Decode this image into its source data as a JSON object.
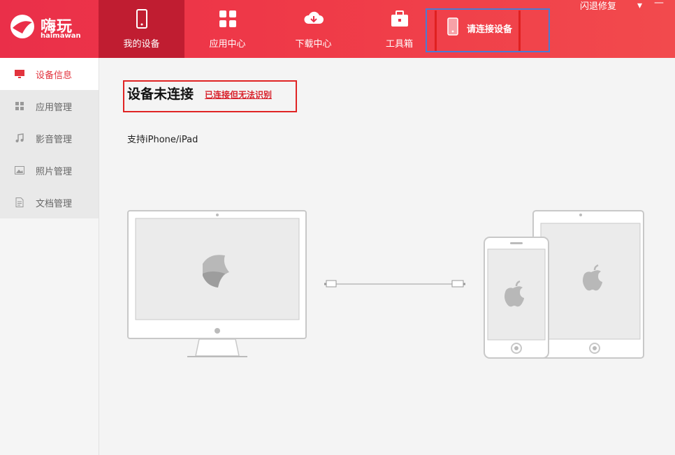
{
  "app": {
    "logo_text": "嗨玩",
    "logo_sub": "haimawan"
  },
  "nav": [
    {
      "label": "我的设备",
      "icon": "phone-icon",
      "active": true
    },
    {
      "label": "应用中心",
      "icon": "apps-grid-icon"
    },
    {
      "label": "下载中心",
      "icon": "cloud-download-icon"
    },
    {
      "label": "工具箱",
      "icon": "toolbox-icon"
    }
  ],
  "connect": {
    "label": "请连接设备",
    "icon": "phone-icon"
  },
  "window": {
    "repair_label": "闪退修复",
    "menu_symbol": "▾",
    "minimize_symbol": "—"
  },
  "sidebar": [
    {
      "label": "设备信息",
      "icon": "monitor-icon",
      "active": true
    },
    {
      "label": "应用管理",
      "icon": "grid-icon"
    },
    {
      "label": "影音管理",
      "icon": "music-note-icon"
    },
    {
      "label": "照片管理",
      "icon": "image-icon"
    },
    {
      "label": "文档管理",
      "icon": "document-icon"
    }
  ],
  "main": {
    "title": "设备未连接",
    "link": "已连接但无法识别",
    "support": "支持iPhone/iPad"
  },
  "colors": {
    "brand": "#ea2f49",
    "active_nav": "#c01d31",
    "highlight_red": "#e02424",
    "highlight_blue": "#4a7bd4"
  }
}
